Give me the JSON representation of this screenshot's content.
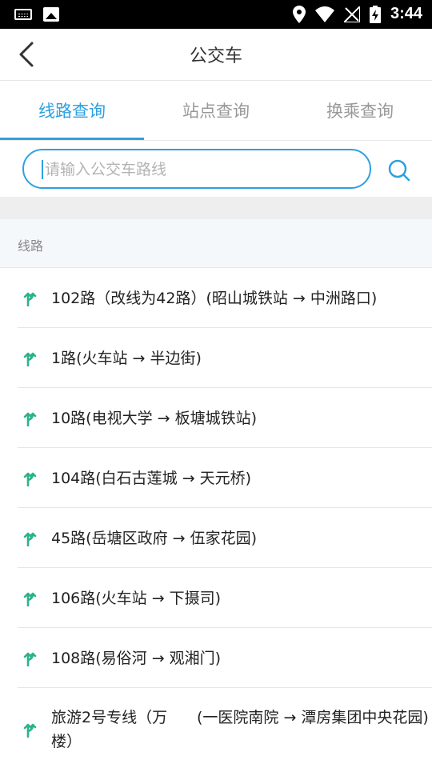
{
  "status": {
    "time": "3:44"
  },
  "header": {
    "title": "公交车"
  },
  "tabs": [
    {
      "label": "线路查询",
      "active": true
    },
    {
      "label": "站点查询",
      "active": false
    },
    {
      "label": "换乘查询",
      "active": false
    }
  ],
  "search": {
    "placeholder": "请输入公交车路线",
    "value": ""
  },
  "section": {
    "label": "线路"
  },
  "routes": [
    "102路（改线为42路）(昭山城铁站 → 中洲路口)",
    "1路(火车站 → 半边街)",
    "10路(电视大学 → 板塘城铁站)",
    "104路(白石古莲城 → 天元桥)",
    "45路(岳塘区政府 → 伍家花园)",
    "106路(火车站 → 下摄司)",
    "108路(易俗河 → 观湘门)"
  ],
  "last_route": {
    "name": "旅游2号专线（万楼）",
    "path": "(一医院南院 → 潭房集团中央花园)"
  },
  "colors": {
    "accent": "#2ea0e0",
    "route_icon": "#2bb38a"
  },
  "icons": {
    "back": "back-arrow-icon",
    "search": "search-icon",
    "route": "route-fork-icon"
  }
}
